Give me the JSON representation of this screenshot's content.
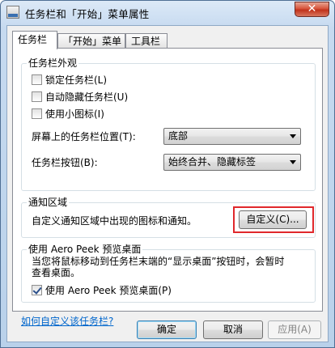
{
  "window": {
    "title": "任务栏和「开始」菜单属性",
    "close_glyph": "✕"
  },
  "tabs": [
    "任务栏",
    "「开始」菜单",
    "工具栏"
  ],
  "appearance": {
    "title": "任务栏外观",
    "lock_label": "锁定任务栏(L)",
    "lock_checked": false,
    "autohide_label": "自动隐藏任务栏(U)",
    "autohide_checked": false,
    "small_icons_label": "使用小图标(I)",
    "small_icons_checked": false,
    "position_label": "屏幕上的任务栏位置(T):",
    "position_value": "底部",
    "buttons_label": "任务栏按钮(B):",
    "buttons_value": "始终合并、隐藏标签"
  },
  "notification": {
    "title": "通知区域",
    "description": "自定义通知区域中出现的图标和通知。",
    "customize_button": "自定义(C)..."
  },
  "aero_peek": {
    "title": "使用 Aero Peek 预览桌面",
    "description_line1": "当您将鼠标移动到任务栏末端的“显示桌面”按钮时，会暂时",
    "description_line2": "查看桌面。",
    "checkbox_label": "使用 Aero Peek 预览桌面(P)",
    "checkbox_checked": true
  },
  "help_link": "如何自定义该任务栏?",
  "buttons": {
    "ok": "确定",
    "cancel": "取消",
    "apply": "应用(A)"
  },
  "colors": {
    "highlight": "#e0282c",
    "link": "#0066cc"
  }
}
